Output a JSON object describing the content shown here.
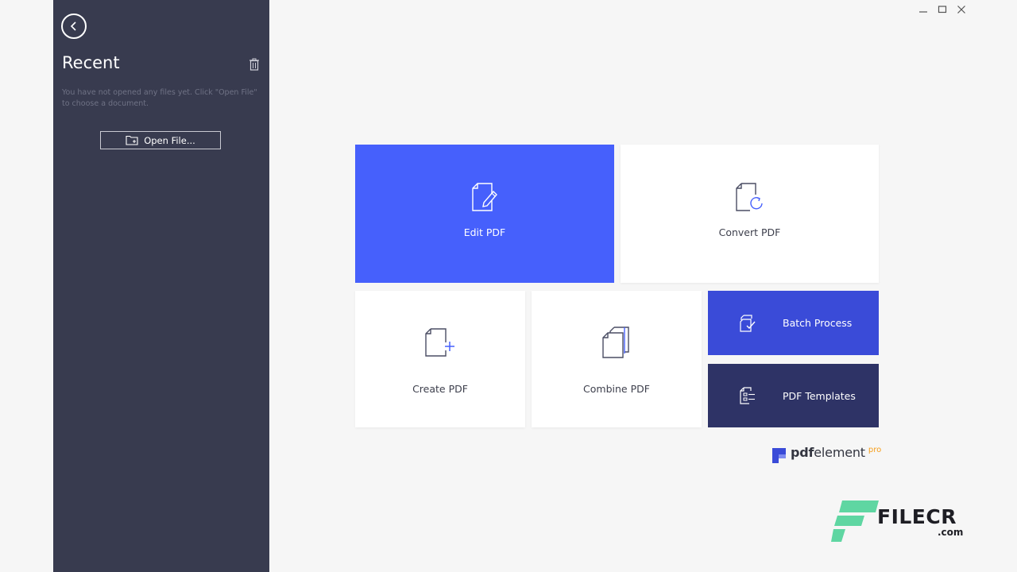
{
  "window": {
    "controls": {
      "minimize": "minimize-icon",
      "maximize": "maximize-icon",
      "close": "close-icon"
    }
  },
  "sidebar": {
    "title": "Recent",
    "empty_message": "You have not opened any files yet. Click \"Open File\" to choose a document.",
    "open_file_label": "Open File...",
    "icons": {
      "back": "back-arrow-icon",
      "trash": "trash-icon",
      "folder": "folder-icon"
    }
  },
  "tiles": {
    "edit": {
      "label": "Edit PDF",
      "icon": "edit-document-icon"
    },
    "convert": {
      "label": "Convert PDF",
      "icon": "convert-document-icon"
    },
    "create": {
      "label": "Create PDF",
      "icon": "create-document-icon"
    },
    "combine": {
      "label": "Combine PDF",
      "icon": "combine-documents-icon"
    },
    "batch": {
      "label": "Batch Process",
      "icon": "batch-process-icon"
    },
    "templates": {
      "label": "PDF Templates",
      "icon": "templates-icon"
    }
  },
  "brand": {
    "bold": "pdf",
    "rest": "element",
    "pro": "pro"
  },
  "watermark": {
    "name": "FILECR",
    "domain": ".com"
  },
  "colors": {
    "sidebar_bg": "#383b4f",
    "accent_blue": "#4660fc",
    "batch_blue": "#3a4bd8",
    "templates_navy": "#2e3366",
    "pro_orange": "#f59e1b",
    "filecr_green": "#5fd6a2"
  }
}
